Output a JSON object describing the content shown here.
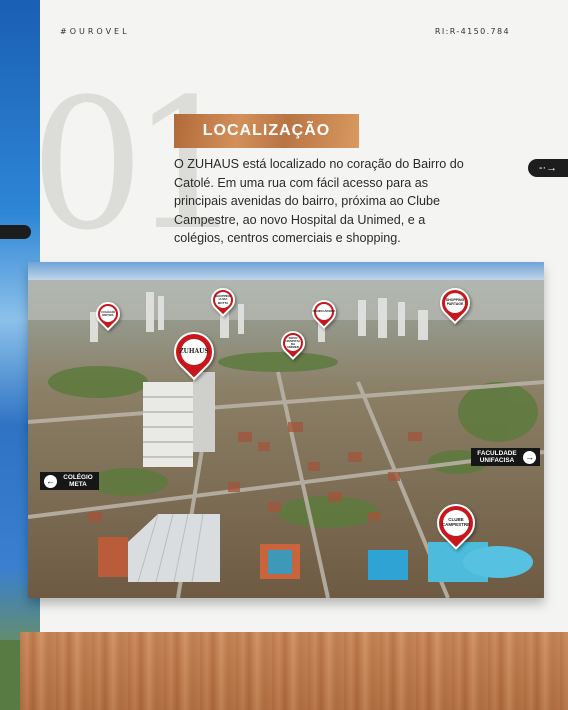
{
  "header": {
    "brand": "#OUROVEL",
    "registration": "RI:R-4150.784"
  },
  "section": {
    "number": "01",
    "title": "LOCALIZAÇÃO",
    "description": "O ZUHAUS está localizado no coração do Bairro do Catolé. Em uma  rua com fácil acesso para as principais avenidas do bairro, próxima ao Clube Campestre, ao novo Hospital da Unimed, e a colégios, centros comerciais e shopping."
  },
  "nav": {
    "next_icon": "arrow-right-icon"
  },
  "map": {
    "main_pin_label": "ZUHAUS",
    "pins": [
      {
        "label": "COLÉGIO MOTIVA"
      },
      {
        "label": "SHOPPING LUIZA MOTTA"
      },
      {
        "label": "PANIFICADORA"
      },
      {
        "label": "NOVO HOSPITAL DA UNIMED"
      },
      {
        "label": "SHOPPING PARTAGE"
      },
      {
        "label": "CLUBE CAMPESTRE"
      }
    ],
    "tags": [
      {
        "label": "COLÉGIO META",
        "direction": "left"
      },
      {
        "label": "FACULDADE UNIFACISA",
        "direction": "right"
      }
    ]
  },
  "colors": {
    "pin_red": "#c8161d",
    "wood": "#c27b48",
    "dark": "#1d1d1d"
  }
}
